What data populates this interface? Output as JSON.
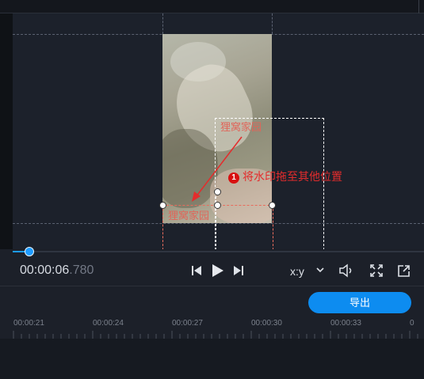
{
  "preview": {
    "watermark_text_moved": "狸窝家园",
    "watermark_text_original": "狸窝家园",
    "annotation": {
      "number": "1",
      "text": "将水印拖至其他位置",
      "color": "#e42c2c"
    }
  },
  "playback": {
    "time_main": "00:00:06",
    "time_ms": ".780",
    "progress_fraction": 0.04,
    "aspect_label": "x:y",
    "icons": {
      "prev": "skip-previous-icon",
      "play": "play-icon",
      "next": "skip-next-icon",
      "volume": "volume-icon",
      "fullscreen": "fullscreen-icon",
      "popout": "popout-icon"
    }
  },
  "export": {
    "button_label": "导出",
    "accent_color": "#0d8cf0"
  },
  "timeline": {
    "ruler_labels": [
      "00:00:21",
      "00:00:24",
      "00:00:27",
      "00:00:30",
      "00:00:33",
      "0"
    ]
  }
}
